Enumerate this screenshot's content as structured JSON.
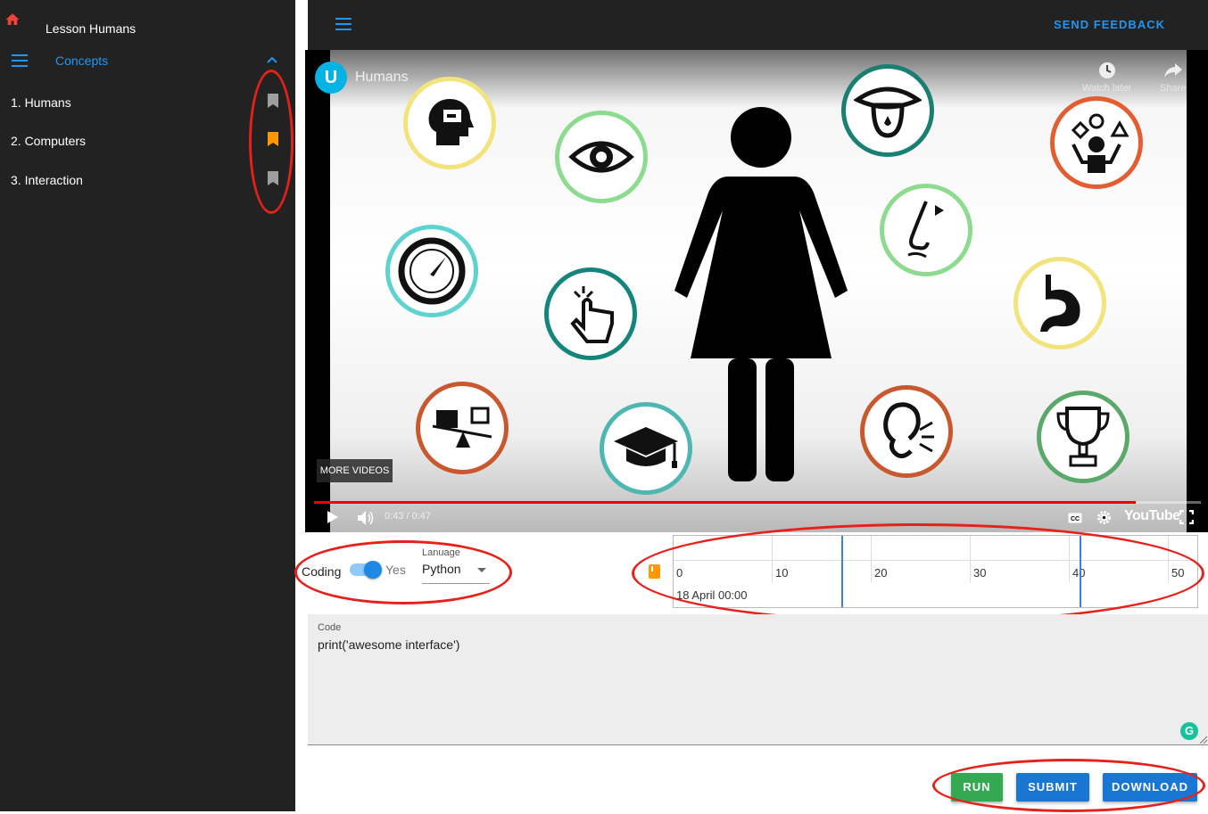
{
  "sidebar": {
    "lesson_title": "Lesson Humans",
    "section_label": "Concepts",
    "items": [
      {
        "label": "1. Humans",
        "bookmark_color": "#9e9e9e"
      },
      {
        "label": "2. Computers",
        "bookmark_color": "#ff9800"
      },
      {
        "label": "3. Interaction",
        "bookmark_color": "#9e9e9e"
      }
    ]
  },
  "topbar": {
    "feedback_label": "SEND FEEDBACK"
  },
  "video": {
    "channel_logo": "U",
    "title": "Humans",
    "watch_later_label": "Watch later",
    "share_label": "Share",
    "more_videos_label": "MORE VIDEOS",
    "time": "0:43 / 0:47",
    "progress_fraction": 0.927,
    "youtube_label": "YouTube"
  },
  "code_options": {
    "coding_label": "Coding",
    "toggle_on": true,
    "toggle_label": "Yes",
    "language_label": "Lanuage",
    "language_value": "Python"
  },
  "timeline": {
    "ticks": [
      "0",
      "10",
      "20",
      "30",
      "40",
      "50"
    ],
    "date": "18 April 00:00",
    "bookmark_color": "#ff9800"
  },
  "code_editor": {
    "label": "Code",
    "value": "print('awesome interface')"
  },
  "actions": {
    "run_label": "RUN",
    "submit_label": "SUBMIT",
    "download_label": "DOWNLOAD"
  },
  "colors": {
    "accent": "#2196f3",
    "run": "#34a853",
    "submit": "#1976d2",
    "annotation": "#e8201a"
  }
}
